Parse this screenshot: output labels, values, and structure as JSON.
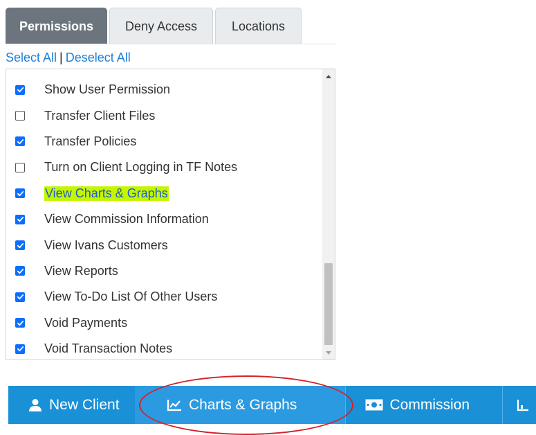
{
  "tabs": [
    {
      "label": "Permissions",
      "active": true
    },
    {
      "label": "Deny Access",
      "active": false
    },
    {
      "label": "Locations",
      "active": false
    }
  ],
  "select_links": {
    "select_all": "Select All",
    "separator": "|",
    "deselect_all": "Deselect All"
  },
  "permissions": [
    {
      "label": "Show User Permission",
      "checked": true
    },
    {
      "label": "Transfer Client Files",
      "checked": false
    },
    {
      "label": "Transfer Policies",
      "checked": true
    },
    {
      "label": "Turn on Client Logging in TF Notes",
      "checked": false
    },
    {
      "label": "View Charts & Graphs",
      "checked": true,
      "highlighted": true
    },
    {
      "label": "View Commission Information",
      "checked": true
    },
    {
      "label": "View Ivans Customers",
      "checked": true
    },
    {
      "label": "View Reports",
      "checked": true
    },
    {
      "label": "View To-Do List Of Other Users",
      "checked": true
    },
    {
      "label": "Void Payments",
      "checked": true
    },
    {
      "label": "Void Transaction Notes",
      "checked": true
    }
  ],
  "toolbar": {
    "new_client": "New Client",
    "charts_graphs": "Charts & Graphs",
    "commission": "Commission"
  },
  "colors": {
    "toolbar_bg": "#1a90d6",
    "active_tab_bg": "#6c757d",
    "checkbox_blue": "#0d6efd",
    "highlight": "#c6f500",
    "annotation_circle": "#d3222a"
  }
}
